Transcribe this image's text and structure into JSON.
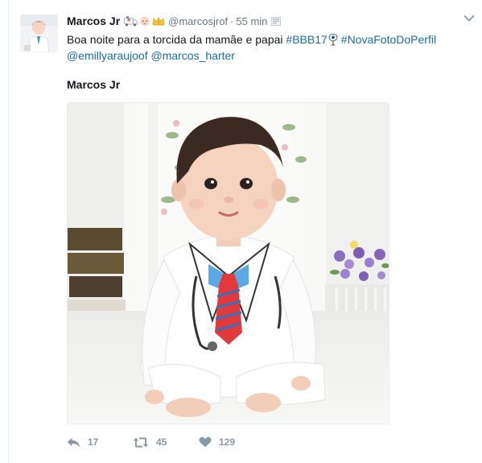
{
  "tweet": {
    "display_name": "Marcos Jr",
    "name_emoji": [
      "ambulance-emoji",
      "baby-emoji",
      "crown-emoji"
    ],
    "handle": "@marcosjrof",
    "separator": "·",
    "time": "55 min",
    "text_plain_1": "Boa noite para a torcida da mamãe e papai ",
    "hashtag_1": "#BBB17",
    "hashtag_2": "#NovaFotoDoPerfil",
    "mention_1": "@emillyaraujoof",
    "mention_2": "@marcos_harter",
    "card_title": "Marcos Jr",
    "media_alt": "baby-photo",
    "actions": {
      "reply_count": "17",
      "retweet_count": "45",
      "like_count": "129"
    }
  },
  "colors": {
    "link": "#1b6d9e",
    "muted": "#657786",
    "action": "#8899a6",
    "text": "#14171a",
    "border": "#e6ecf0"
  }
}
